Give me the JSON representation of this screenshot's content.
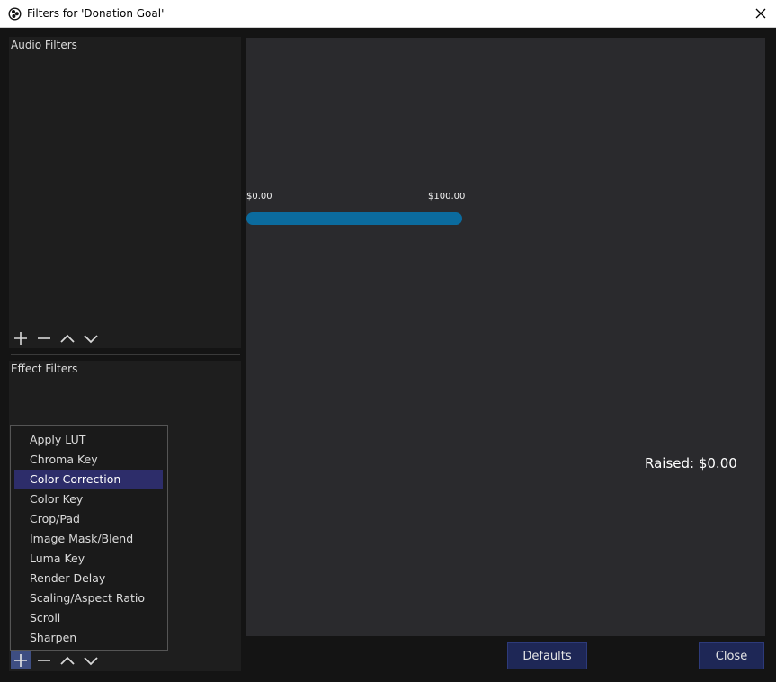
{
  "window": {
    "title": "Filters for 'Donation Goal'",
    "app_icon": "obs-icon",
    "close_icon": "close-icon"
  },
  "audio_filters": {
    "label": "Audio Filters",
    "toolbar": [
      "add-icon",
      "remove-icon",
      "move-up-icon",
      "move-down-icon"
    ]
  },
  "effect_filters": {
    "label": "Effect Filters",
    "toolbar": [
      "add-icon",
      "remove-icon",
      "move-up-icon",
      "move-down-icon"
    ]
  },
  "add_menu": {
    "items": [
      "Apply LUT",
      "Chroma Key",
      "Color Correction",
      "Color Key",
      "Crop/Pad",
      "Image Mask/Blend",
      "Luma Key",
      "Render Delay",
      "Scaling/Aspect Ratio",
      "Scroll",
      "Sharpen"
    ],
    "highlighted": "Color Correction"
  },
  "preview": {
    "goal_min": "$0.00",
    "goal_max": "$100.00",
    "progress_fraction": 0,
    "raised_text": "Raised: $0.00"
  },
  "buttons": {
    "defaults": "Defaults",
    "close": "Close"
  },
  "colors": {
    "accent": "#1e2756",
    "menu_highlight": "#2d2d6a",
    "progress_track": "#0b6b9e"
  }
}
